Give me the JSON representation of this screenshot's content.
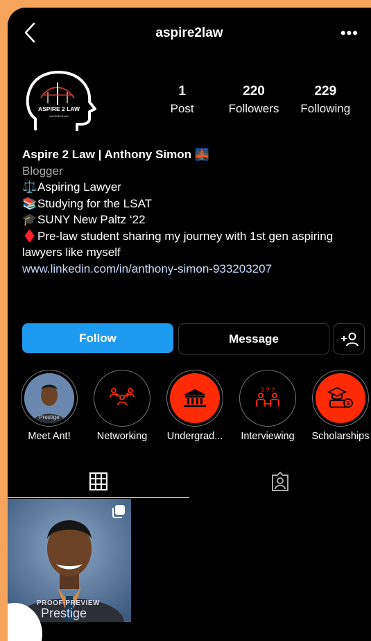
{
  "header": {
    "username": "aspire2law",
    "back_icon": "chevron-left-icon",
    "more_icon": "more-horizontal-icon",
    "more_label": "•••"
  },
  "avatar": {
    "logo_text": "ASPIRE 2 LAW",
    "logo_subtext": "#ASPIRE2LAW"
  },
  "stats": [
    {
      "value": "1",
      "label": "Post"
    },
    {
      "value": "220",
      "label": "Followers"
    },
    {
      "value": "229",
      "label": "Following"
    }
  ],
  "bio": {
    "name": "Aspire 2 Law | Anthony Simon 🌉",
    "category": "Blogger",
    "lines": [
      {
        "emoji": "⚖️",
        "text": "Aspiring Lawyer"
      },
      {
        "emoji": "📚",
        "text": "Studying for the LSAT"
      },
      {
        "emoji": "🎓",
        "text": "SUNY New Paltz ‘22"
      },
      {
        "emoji": "♦️",
        "text": "Pre-law student sharing my journey with 1st gen aspiring lawyers like myself"
      }
    ],
    "link": "www.linkedin.com/in/anthony-simon-933203207"
  },
  "actions": {
    "follow_label": "Follow",
    "message_label": "Message",
    "add_user_icon": "add-user-icon"
  },
  "highlights": [
    {
      "label": "Meet Ant!",
      "icon": "photo-avatar",
      "overlay": "Prestige"
    },
    {
      "label": "Networking",
      "icon": "network-people-icon"
    },
    {
      "label": "Undergrad...",
      "icon": "university-building-icon"
    },
    {
      "label": "Interviewing",
      "icon": "interview-icon"
    },
    {
      "label": "Scholarships",
      "icon": "scholarship-icon"
    }
  ],
  "tabs": [
    {
      "name": "posts-grid",
      "icon": "grid-icon",
      "active": true
    },
    {
      "name": "tagged",
      "icon": "tagged-person-icon",
      "active": false
    }
  ],
  "posts": [
    {
      "watermark_top": "PROOF PREVIEW",
      "watermark_bottom": "Prestige",
      "type_icon": "multiple-photos-icon"
    }
  ],
  "colors": {
    "background_frame": "#f5a65b",
    "follow_button": "#1d9bf0",
    "highlight_red": "#ff2a06",
    "link": "#c7d8ff"
  }
}
